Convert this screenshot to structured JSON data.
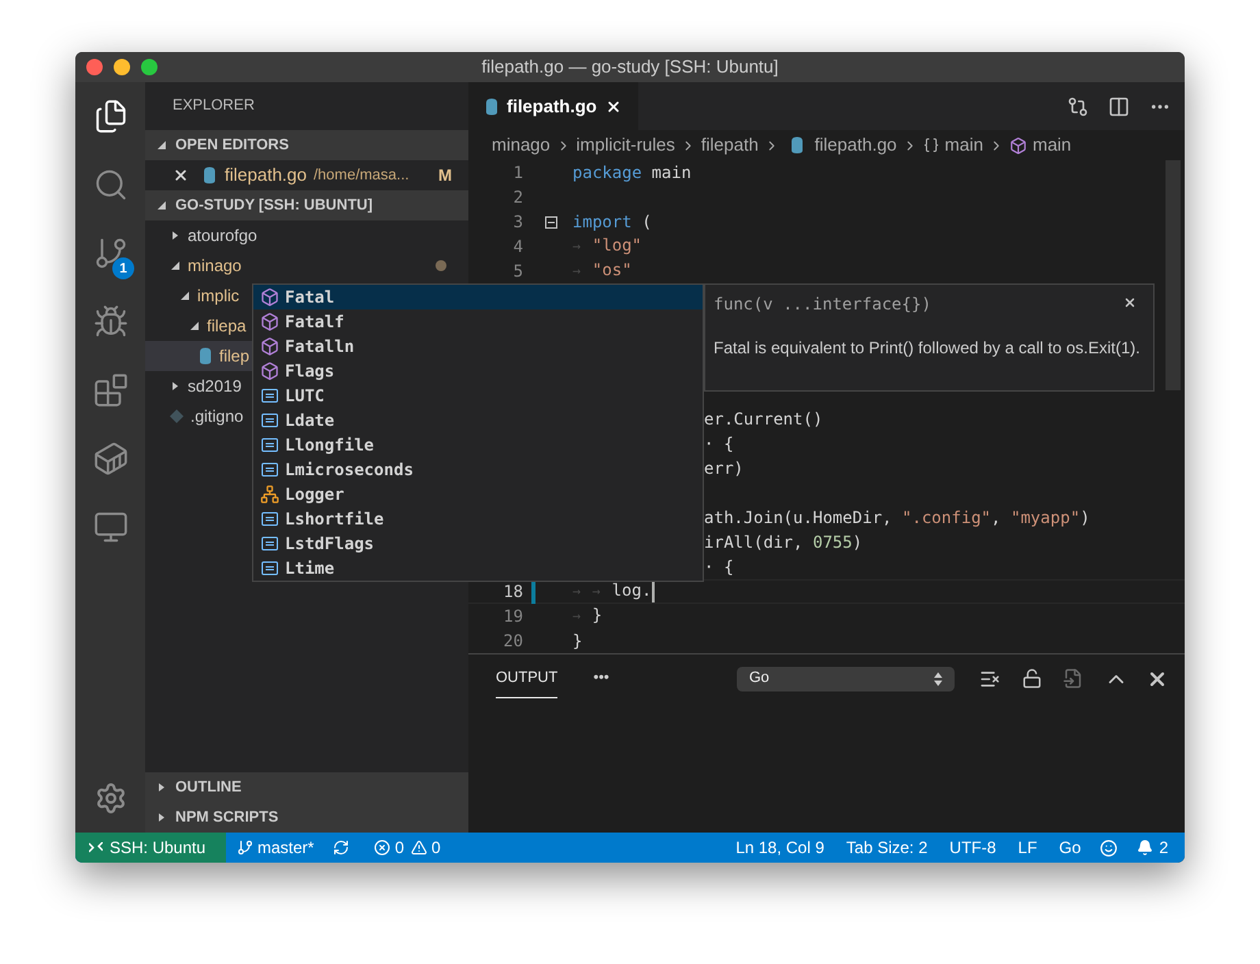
{
  "window": {
    "title": "filepath.go — go-study [SSH: Ubuntu]"
  },
  "activity_bar": {
    "items": [
      {
        "kind": "files",
        "selected": true
      },
      {
        "kind": "search",
        "selected": false
      },
      {
        "kind": "scm",
        "selected": false,
        "badge": "1"
      },
      {
        "kind": "debug",
        "selected": false
      },
      {
        "kind": "extensions",
        "selected": false
      },
      {
        "kind": "docker",
        "selected": false
      },
      {
        "kind": "remote",
        "selected": false
      }
    ]
  },
  "sidebar": {
    "title": "EXPLORER",
    "open_editors": {
      "title": "OPEN EDITORS",
      "expanded": true,
      "items": [
        {
          "name": "filepath.go",
          "path": "/home/masa...",
          "status": "M"
        }
      ]
    },
    "workspace": {
      "title": "GO-STUDY [SSH: UBUNTU]",
      "expanded": true,
      "tree": [
        {
          "name": "atourofgo",
          "kind": "folder",
          "expanded": false,
          "modified": false,
          "selected": false
        },
        {
          "name": "minago",
          "kind": "folder",
          "expanded": true,
          "modified": true,
          "selected": false,
          "children": [
            {
              "name": "implic",
              "kind": "folder",
              "expanded": true,
              "modified": true,
              "selected": false,
              "children": [
                {
                  "name": "filepa",
                  "kind": "folder",
                  "expanded": true,
                  "modified": true,
                  "selected": false,
                  "children": [
                    {
                      "name": "filep",
                      "kind": "file",
                      "modified": true,
                      "selected": true
                    }
                  ]
                }
              ]
            }
          ]
        },
        {
          "name": "sd2019",
          "kind": "folder",
          "expanded": false,
          "modified": false,
          "selected": false
        },
        {
          "name": ".gitigno",
          "kind": "gitfile",
          "modified": false,
          "selected": false
        }
      ]
    },
    "bottom_sections": [
      {
        "title": "OUTLINE",
        "expanded": false
      },
      {
        "title": "NPM SCRIPTS",
        "expanded": false
      }
    ]
  },
  "editor": {
    "tabs": [
      {
        "label": "filepath.go",
        "selected": true
      }
    ],
    "breadcrumbs": [
      {
        "label": "minago",
        "kind": "folder"
      },
      {
        "label": "implicit-rules",
        "kind": "folder"
      },
      {
        "label": "filepath",
        "kind": "folder"
      },
      {
        "label": "filepath.go",
        "kind": "gofile"
      },
      {
        "label": "main",
        "kind": "braces"
      },
      {
        "label": "main",
        "kind": "method"
      }
    ],
    "lines": [
      {
        "kind": "full",
        "number": "1",
        "tokens": [
          {
            "text": "package",
            "kind": "keyword"
          },
          {
            "text": " main",
            "kind": "plain"
          }
        ]
      },
      {
        "kind": "full",
        "number": "2"
      },
      {
        "kind": "full",
        "number": "3",
        "fold": true,
        "tokens": [
          {
            "text": "import",
            "kind": "keyword"
          },
          {
            "text": " (",
            "kind": "plain"
          }
        ]
      },
      {
        "kind": "full",
        "number": "4",
        "tokens": [
          {
            "text": "→",
            "kind": "tab"
          },
          {
            "text": "\"log\"",
            "kind": "string"
          }
        ]
      },
      {
        "kind": "full",
        "number": "5",
        "tokens": [
          {
            "text": "→",
            "kind": "tab"
          },
          {
            "text": "\"os\"",
            "kind": "string"
          }
        ]
      },
      {
        "kind": "covered"
      },
      {
        "kind": "covered"
      },
      {
        "kind": "covered"
      },
      {
        "kind": "covered"
      },
      {
        "kind": "covered"
      },
      {
        "kind": "partial",
        "tokens": [
          {
            "text": "er.Current()",
            "kind": "plain"
          }
        ]
      },
      {
        "kind": "partial",
        "tokens": [
          {
            "text": "· {",
            "kind": "plain"
          }
        ]
      },
      {
        "kind": "partial",
        "tokens": [
          {
            "text": "err)",
            "kind": "plain"
          }
        ]
      },
      {
        "kind": "covered"
      },
      {
        "kind": "partial",
        "tokens": [
          {
            "text": "ath.Join(u.HomeDir, ",
            "kind": "plain"
          },
          {
            "text": "\".config\"",
            "kind": "string"
          },
          {
            "text": ", ",
            "kind": "plain"
          },
          {
            "text": "\"myapp\"",
            "kind": "string"
          },
          {
            "text": ")",
            "kind": "plain"
          }
        ]
      },
      {
        "kind": "partial",
        "tokens": [
          {
            "text": "irAll(dir, ",
            "kind": "plain"
          },
          {
            "text": "0755",
            "kind": "number"
          },
          {
            "text": ")",
            "kind": "plain"
          }
        ]
      },
      {
        "kind": "partial",
        "tokens": [
          {
            "text": "· {",
            "kind": "plain"
          }
        ]
      },
      {
        "kind": "full",
        "number": "18",
        "current": true,
        "modified": true,
        "tokens": [
          {
            "text": "→",
            "kind": "tab"
          },
          {
            "text": "→",
            "kind": "tab"
          },
          {
            "text": "log.",
            "kind": "plain"
          }
        ]
      },
      {
        "kind": "full",
        "number": "19",
        "tokens": [
          {
            "text": "→",
            "kind": "tab"
          },
          {
            "text": "}",
            "kind": "plain"
          }
        ]
      },
      {
        "kind": "full",
        "number": "20",
        "tokens": [
          {
            "text": "}",
            "kind": "plain"
          }
        ]
      }
    ],
    "suggestions": [
      {
        "label": "Fatal",
        "kind": "method",
        "selected": true
      },
      {
        "label": "Fatalf",
        "kind": "method",
        "selected": false
      },
      {
        "label": "Fatalln",
        "kind": "method",
        "selected": false
      },
      {
        "label": "Flags",
        "kind": "method",
        "selected": false
      },
      {
        "label": "LUTC",
        "kind": "constant",
        "selected": false
      },
      {
        "label": "Ldate",
        "kind": "constant",
        "selected": false
      },
      {
        "label": "Llongfile",
        "kind": "constant",
        "selected": false
      },
      {
        "label": "Lmicroseconds",
        "kind": "constant",
        "selected": false
      },
      {
        "label": "Logger",
        "kind": "class",
        "selected": false
      },
      {
        "label": "Lshortfile",
        "kind": "constant",
        "selected": false
      },
      {
        "label": "LstdFlags",
        "kind": "constant",
        "selected": false
      },
      {
        "label": "Ltime",
        "kind": "constant",
        "selected": false
      }
    ],
    "hover": {
      "signature": "func(v ...interface{})",
      "description": "Fatal is equivalent to Print() followed by a call to os.Exit(1)."
    }
  },
  "panel": {
    "tabs": [
      {
        "label": "OUTPUT",
        "selected": true
      }
    ],
    "more": "•••",
    "channel": "Go"
  },
  "status_bar": {
    "remote": "SSH: Ubuntu",
    "branch": "master*",
    "errors": "0",
    "warnings": "0",
    "position": "Ln 18, Col 9",
    "tab_size": "Tab Size: 2",
    "encoding": "UTF-8",
    "eol": "LF",
    "language": "Go",
    "notifications": "2"
  }
}
